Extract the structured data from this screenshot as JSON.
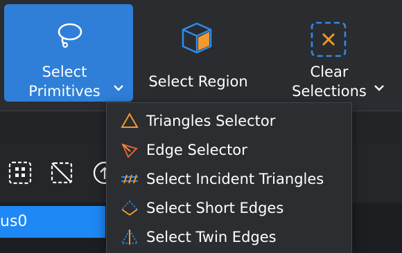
{
  "toolbar": {
    "select_primitives": {
      "line1": "Select",
      "line2": "Primitives",
      "icon": "lasso-icon"
    },
    "select_region": {
      "label": "Select Region",
      "icon": "cube-icon"
    },
    "clear_selections": {
      "line1": "Clear",
      "line2": "Selections",
      "icon": "clear-x-icon"
    }
  },
  "dropdown": {
    "items": [
      {
        "label": "Triangles Selector",
        "icon": "triangle-icon"
      },
      {
        "label": "Edge Selector",
        "icon": "edge-arrow-icon"
      },
      {
        "label": "Select Incident Triangles",
        "icon": "incident-triangles-icon"
      },
      {
        "label": "Select Short Edges",
        "icon": "short-edges-icon"
      },
      {
        "label": "Select Twin Edges",
        "icon": "twin-edges-icon"
      }
    ]
  },
  "list": {
    "selected_item": "us0"
  },
  "colors": {
    "accent": "#2f7fd8",
    "selection": "#1e88f4",
    "orange": "#f29a2e"
  }
}
